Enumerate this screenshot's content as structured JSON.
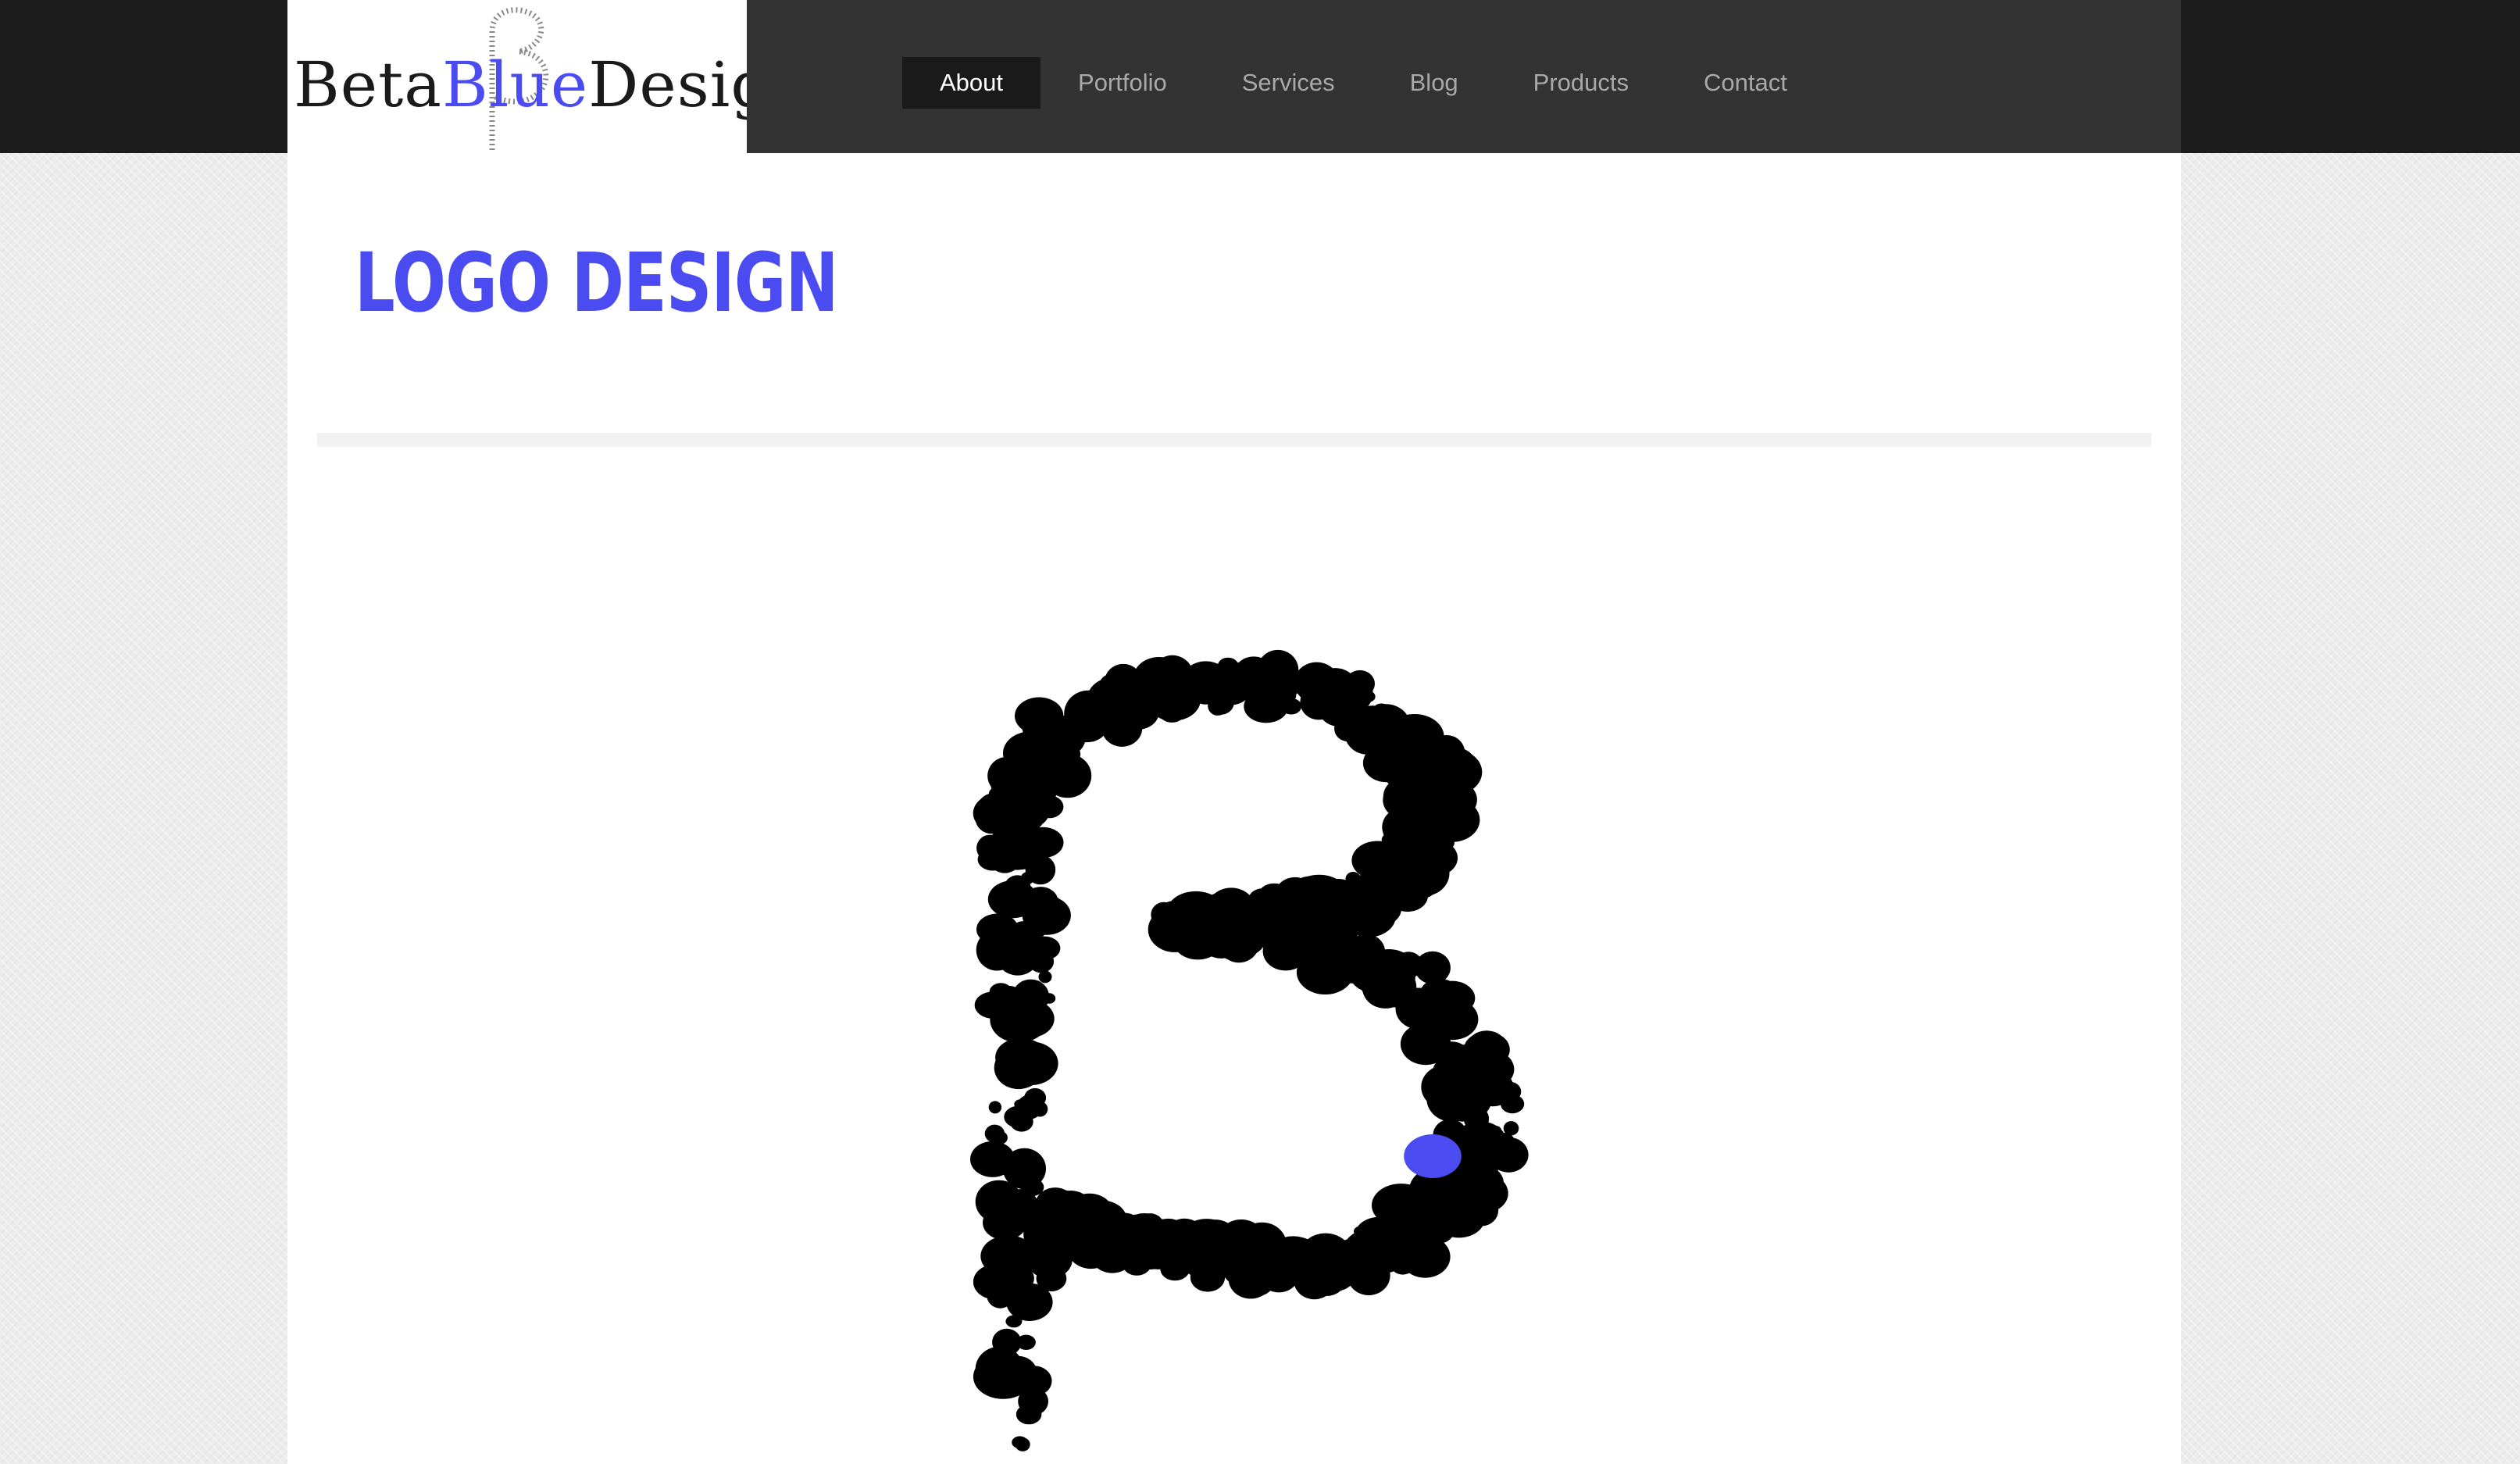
{
  "header": {
    "brand": {
      "name": "BetaBlueDesign",
      "part_beta": "Beta",
      "part_blue": "Blue",
      "part_design": "Design",
      "accent_color": "#4b4bf2"
    },
    "nav": [
      {
        "label": "About",
        "active": true
      },
      {
        "label": "Portfolio",
        "active": false
      },
      {
        "label": "Services",
        "active": false
      },
      {
        "label": "Blog",
        "active": false
      },
      {
        "label": "Products",
        "active": false
      },
      {
        "label": "Contact",
        "active": false
      }
    ]
  },
  "main": {
    "title": "LOGO DESIGN",
    "title_color": "#4b4bf2",
    "artwork_icon": "dotted-beta-letter"
  }
}
